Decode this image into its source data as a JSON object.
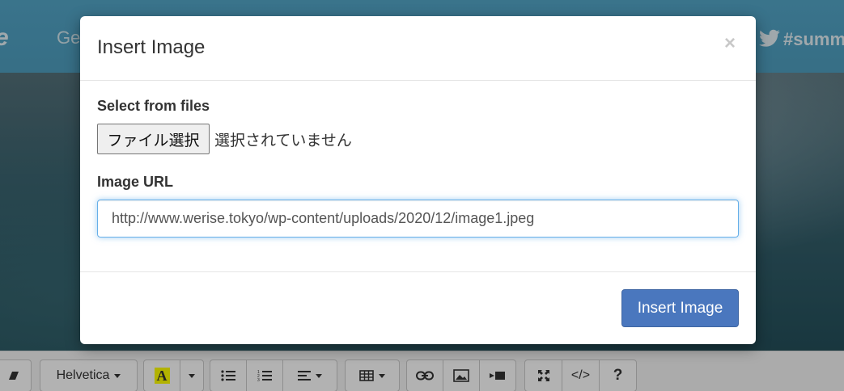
{
  "background": {
    "brand_text": "e",
    "nav_text": "Ge",
    "hashtag": "#summe",
    "icons": [
      "twitter-icon"
    ]
  },
  "modal": {
    "title": "Insert Image",
    "close_label": "×",
    "select_files_label": "Select from files",
    "file_button_label": "ファイル選択",
    "file_status": "選択されていません",
    "image_url_label": "Image URL",
    "image_url_value": "http://www.werise.tokyo/wp-content/uploads/2020/12/image1.jpeg",
    "insert_button_label": "Insert Image"
  },
  "toolbar": {
    "font_name": "Helvetica",
    "color_button_label": "A",
    "codeview_label": "</>",
    "help_label": "?",
    "icons": [
      "eraser-icon",
      "font-color-icon",
      "unordered-list-icon",
      "ordered-list-icon",
      "align-icon",
      "table-icon",
      "link-icon",
      "picture-icon",
      "video-icon",
      "fullscreen-icon",
      "code-icon",
      "help-icon"
    ]
  },
  "colors": {
    "header": "#53a6c8",
    "primary_button": "#4a77be",
    "font_color_highlight": "#ffff00"
  }
}
